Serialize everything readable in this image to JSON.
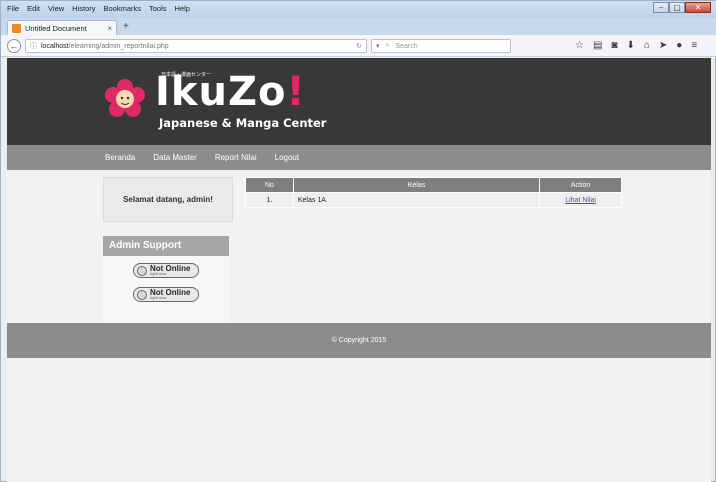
{
  "browser": {
    "menu": [
      "File",
      "Edit",
      "View",
      "History",
      "Bookmarks",
      "Tools",
      "Help"
    ],
    "tab_title": "Untitled Document",
    "tab_close": "×",
    "new_tab": "+",
    "url_host": "localhost",
    "url_path": "/elearning/admin_reportnilai.php",
    "search_placeholder": "Search",
    "controls": {
      "min": "–",
      "max": "▢",
      "close": "✕"
    }
  },
  "site": {
    "logo_title": "IkuZo",
    "logo_bang": "!",
    "logo_japanese": "日本語・漫画センター",
    "logo_subtitle": "Japanese & Manga Center",
    "brand_color": "#e02a67"
  },
  "nav": {
    "items": [
      "Beranda",
      "Data Master",
      "Report Nilai",
      "Logout"
    ]
  },
  "sidebar": {
    "welcome": "Selamat datang, admin!",
    "support_title": "Admin Support",
    "status": [
      {
        "main": "Not Online",
        "sub": "right now"
      },
      {
        "main": "Not Online",
        "sub": "right now"
      }
    ]
  },
  "table": {
    "headers": [
      "No",
      "Kelas",
      "Action"
    ],
    "rows": [
      {
        "no": "1.",
        "kelas": "Kelas 1A",
        "action": "Lihat Nilai"
      }
    ]
  },
  "footer": {
    "copyright": "© Copyright 2015"
  },
  "icons": [
    "back-arrow-icon",
    "site-info-icon",
    "reload-icon",
    "search-icon",
    "bookmark-star-icon",
    "reading-list-icon",
    "pocket-icon",
    "download-icon",
    "home-icon",
    "send-icon",
    "menu-icon"
  ]
}
